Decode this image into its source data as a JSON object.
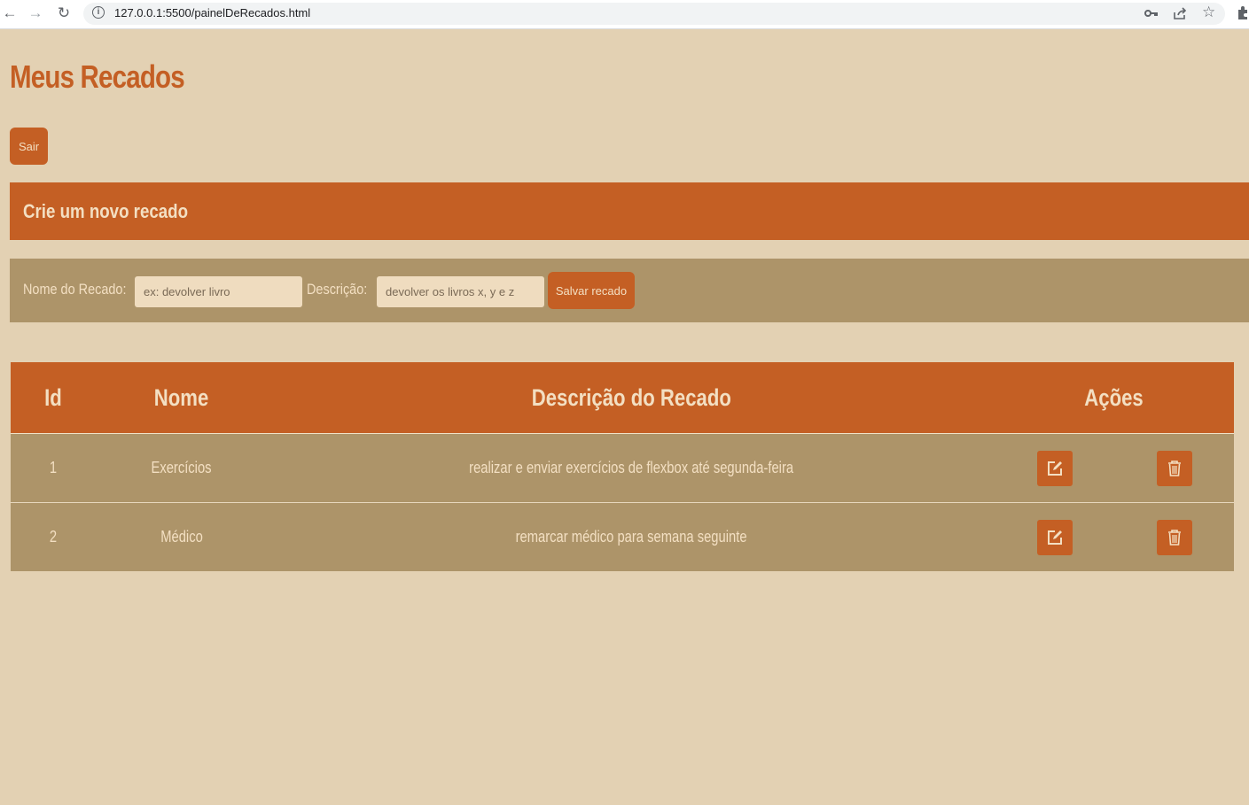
{
  "browser": {
    "url": "127.0.0.1:5500/painelDeRecados.html"
  },
  "page": {
    "title": "Meus Recados",
    "logout_label": "Sair"
  },
  "create": {
    "heading": "Crie um novo recado",
    "name_label": "Nome do Recado:",
    "name_placeholder": "ex: devolver livro",
    "desc_label": "Descrição:",
    "desc_placeholder": "devolver os livros x, y e z",
    "save_label": "Salvar recado"
  },
  "table": {
    "headers": [
      "Id",
      "Nome",
      "Descrição do Recado",
      "Ações"
    ],
    "rows": [
      {
        "id": "1",
        "name": "Exercícios",
        "description": "realizar e enviar exercícios de flexbox até segunda-feira"
      },
      {
        "id": "2",
        "name": "Médico",
        "description": "remarcar médico para semana seguinte"
      }
    ]
  },
  "colors": {
    "background": "#e3d1b3",
    "accent": "#c45f24",
    "panel": "#ad9469",
    "text_light": "#f3dfc2"
  }
}
